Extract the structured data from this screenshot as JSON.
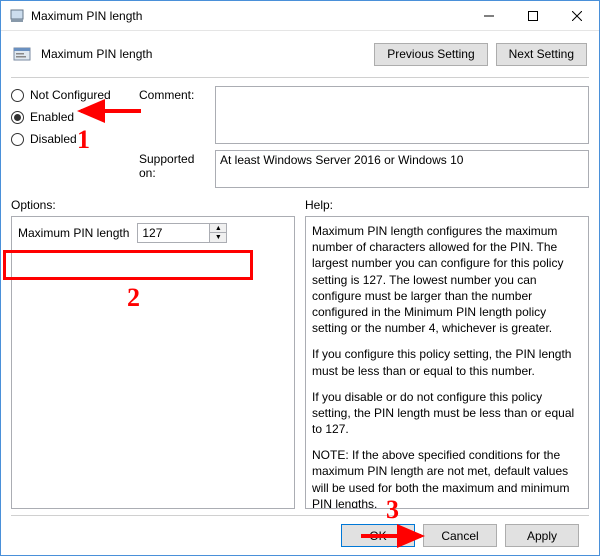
{
  "window": {
    "title": "Maximum PIN length"
  },
  "header": {
    "policy_name": "Maximum PIN length",
    "prev_btn": "Previous Setting",
    "next_btn": "Next Setting"
  },
  "config": {
    "not_configured": "Not Configured",
    "enabled": "Enabled",
    "disabled": "Disabled",
    "selected": "enabled",
    "comment_label": "Comment:",
    "comment_value": "",
    "supported_label": "Supported on:",
    "supported_value": "At least Windows Server 2016 or Windows 10"
  },
  "labels": {
    "options": "Options:",
    "help": "Help:"
  },
  "options": {
    "max_pin_label": "Maximum PIN length",
    "max_pin_value": "127"
  },
  "help": {
    "p1": "Maximum PIN length configures the maximum number of characters allowed for the PIN.  The largest number you can configure for this policy setting is 127. The lowest number you can configure must be larger than the number configured in the Minimum PIN length policy setting or the number 4, whichever is greater.",
    "p2": "If you configure this policy setting, the PIN length must be less than or equal to this number.",
    "p3": "If you disable or do not configure this policy setting, the PIN length must be less than or equal to 127.",
    "p4": "NOTE: If the above specified conditions for the maximum PIN length are not met, default values will be used for both the maximum and minimum PIN lengths."
  },
  "footer": {
    "ok": "OK",
    "cancel": "Cancel",
    "apply": "Apply"
  },
  "annotations": {
    "n1": "1",
    "n2": "2",
    "n3": "3"
  }
}
